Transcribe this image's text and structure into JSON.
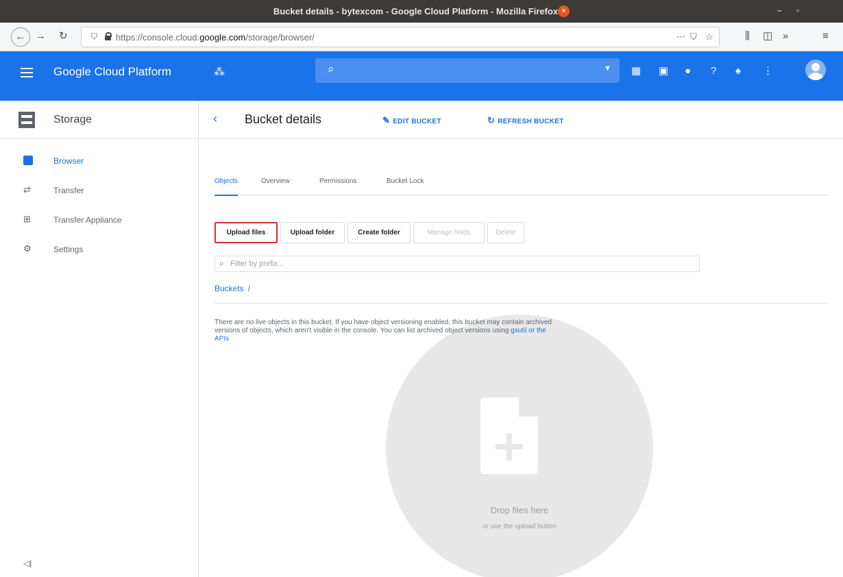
{
  "window": {
    "title": "Bucket details - bytexcom - Google Cloud Platform - Mozilla Firefox",
    "minimize": "–",
    "maximize": "▫",
    "close": "×"
  },
  "browser": {
    "url_prefix": "https://console.cloud.",
    "url_domain": "google.com",
    "url_path": "/storage/browser/"
  },
  "gcp": {
    "title": "Google Cloud Platform"
  },
  "sidebar": {
    "title": "Storage",
    "items": [
      {
        "label": "Browser",
        "icon": "browser-icon",
        "active": true
      },
      {
        "label": "Transfer",
        "icon": "transfer-icon",
        "active": false
      },
      {
        "label": "Transfer Appliance",
        "icon": "transfer-appliance-icon",
        "active": false
      },
      {
        "label": "Settings",
        "icon": "settings-icon",
        "active": false
      }
    ],
    "collapse": "◁|"
  },
  "page": {
    "title": "Bucket details",
    "edit_bucket": "EDIT BUCKET",
    "refresh_bucket": "REFRESH BUCKET"
  },
  "tabs": [
    "Objects",
    "Overview",
    "Permissions",
    "Bucket Lock"
  ],
  "buttons": {
    "upload_files": "Upload files",
    "upload_folder": "Upload folder",
    "create_folder": "Create folder",
    "manage_holds": "Manage holds",
    "delete": "Delete"
  },
  "filter": {
    "placeholder": "Filter by prefix..."
  },
  "breadcrumb": {
    "buckets": "Buckets",
    "separator": "/"
  },
  "info": {
    "text": "There are no live objects in this bucket. If you have object versioning enabled, this bucket may contain archived versions of objects, which aren't visible in the console. You can list archived object versions using ",
    "link": "gsutil or the APIs"
  },
  "dropzone": {
    "title": "Drop files here",
    "subtitle": "or use the upload button"
  },
  "colors": {
    "accent": "#1a73e8",
    "highlight": "#d32f2f"
  }
}
